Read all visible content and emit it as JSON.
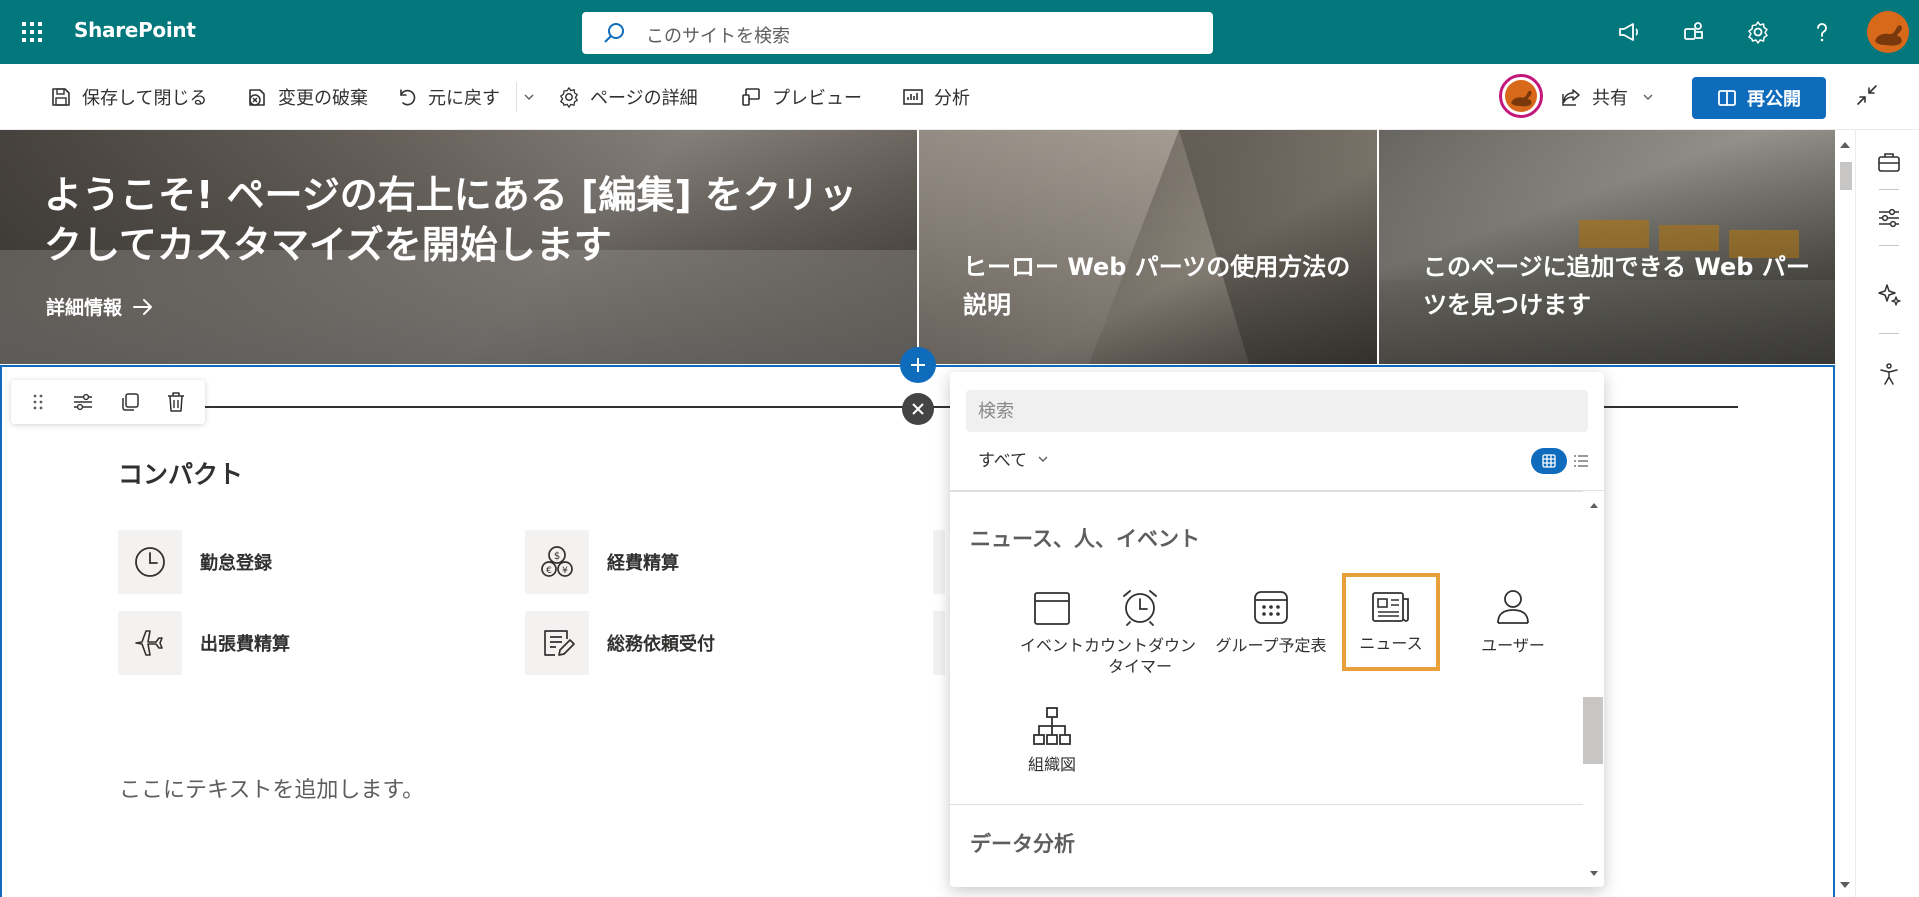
{
  "suite": {
    "app_name": "SharePoint",
    "search_placeholder": "このサイトを検索",
    "icons": [
      "waffle-icon",
      "megaphone-icon",
      "teams-app-icon",
      "gear-icon",
      "help-icon"
    ],
    "accent": "#03787c"
  },
  "command_bar": {
    "save_close": "保存して閉じる",
    "discard": "変更の破棄",
    "undo": "元に戻す",
    "page_details": "ページの詳細",
    "preview": "プレビュー",
    "analytics": "分析",
    "share": "共有",
    "republish": "再公開",
    "republish_color": "#0f6cbd"
  },
  "hero": {
    "main_title": "ようこそ! ページの右上にある [編集] をクリックしてカスタマイズを開始します",
    "main_link": "詳細情報",
    "tile2_title": "ヒーロー Web パーツの使用方法の説明",
    "tile3_title": "このページに追加できる Web パーツを見つけます"
  },
  "quick_links": {
    "title": "コンパクト",
    "items": [
      {
        "label": "勤怠登録",
        "icon": "clock-icon"
      },
      {
        "label": "経費精算",
        "icon": "currency-exchange-icon"
      },
      {
        "label": "出張費精算",
        "icon": "airplane-icon"
      },
      {
        "label": "総務依頼受付",
        "icon": "form-edit-icon"
      }
    ]
  },
  "text_placeholder": "ここにテキストを追加します。",
  "picker": {
    "search_placeholder": "検索",
    "filter_label": "すべて",
    "category1": "ニュース、人、イベント",
    "tiles": [
      {
        "label": "イベント",
        "icon": "calendar-icon"
      },
      {
        "label": "カウントダウン タイマー",
        "icon": "alarm-clock-icon"
      },
      {
        "label": "グループ予定表",
        "icon": "group-calendar-icon"
      },
      {
        "label": "ニュース",
        "icon": "news-icon",
        "selected": true
      },
      {
        "label": "ユーザー",
        "icon": "person-icon"
      },
      {
        "label": "組織図",
        "icon": "org-chart-icon"
      }
    ],
    "category2": "データ分析",
    "selection_color": "#e8a13a"
  }
}
